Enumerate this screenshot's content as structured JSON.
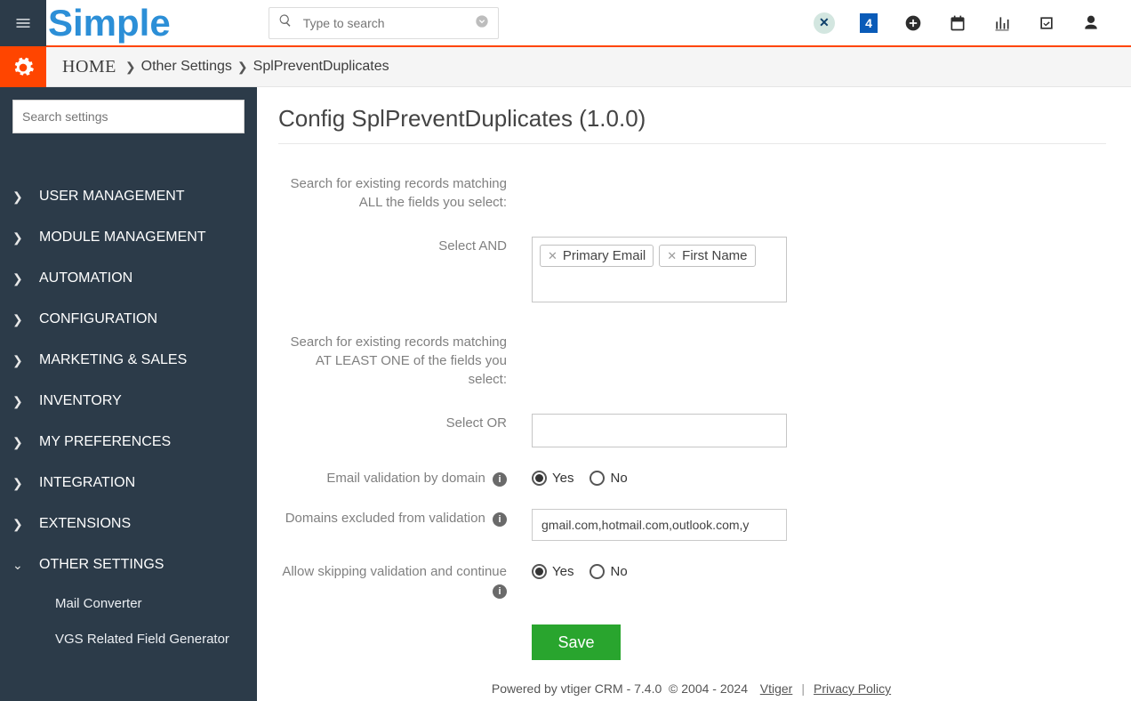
{
  "topbar": {
    "brand": "Simple",
    "search_placeholder": "Type to search"
  },
  "breadcrumb": {
    "home": "HOME",
    "path1": "Other Settings",
    "path2": "SplPreventDuplicates"
  },
  "sidebar": {
    "search_placeholder": "Search settings",
    "items": [
      {
        "label": "USER MANAGEMENT",
        "expanded": false
      },
      {
        "label": "MODULE MANAGEMENT",
        "expanded": false
      },
      {
        "label": "AUTOMATION",
        "expanded": false
      },
      {
        "label": "CONFIGURATION",
        "expanded": false
      },
      {
        "label": "MARKETING & SALES",
        "expanded": false
      },
      {
        "label": "INVENTORY",
        "expanded": false
      },
      {
        "label": "MY PREFERENCES",
        "expanded": false
      },
      {
        "label": "INTEGRATION",
        "expanded": false
      },
      {
        "label": "EXTENSIONS",
        "expanded": false
      },
      {
        "label": "OTHER SETTINGS",
        "expanded": true
      }
    ],
    "sub_items": [
      {
        "label": "Mail Converter"
      },
      {
        "label": "VGS Related Field Generator"
      }
    ]
  },
  "page": {
    "title": "Config SplPreventDuplicates (1.0.0)",
    "desc_and": "Search for existing records matching ALL the fields you select:",
    "label_and": "Select AND",
    "tags_and": [
      "Primary Email",
      "First Name"
    ],
    "desc_or": "Search for existing records matching AT LEAST ONE of the fields you select:",
    "label_or": "Select OR",
    "label_emailval": "Email validation by domain",
    "emailval_yes": "Yes",
    "emailval_no": "No",
    "emailval_value": "yes",
    "label_domains": "Domains excluded from validation",
    "domains_value": "gmail.com,hotmail.com,outlook.com,y",
    "label_skip": "Allow skipping validation and continue",
    "skip_value": "yes",
    "save": "Save"
  },
  "footer": {
    "powered": "Powered by vtiger CRM - 7.4.0",
    "copyright": "© 2004 - 2024",
    "link1": "Vtiger",
    "link2": "Privacy Policy"
  }
}
